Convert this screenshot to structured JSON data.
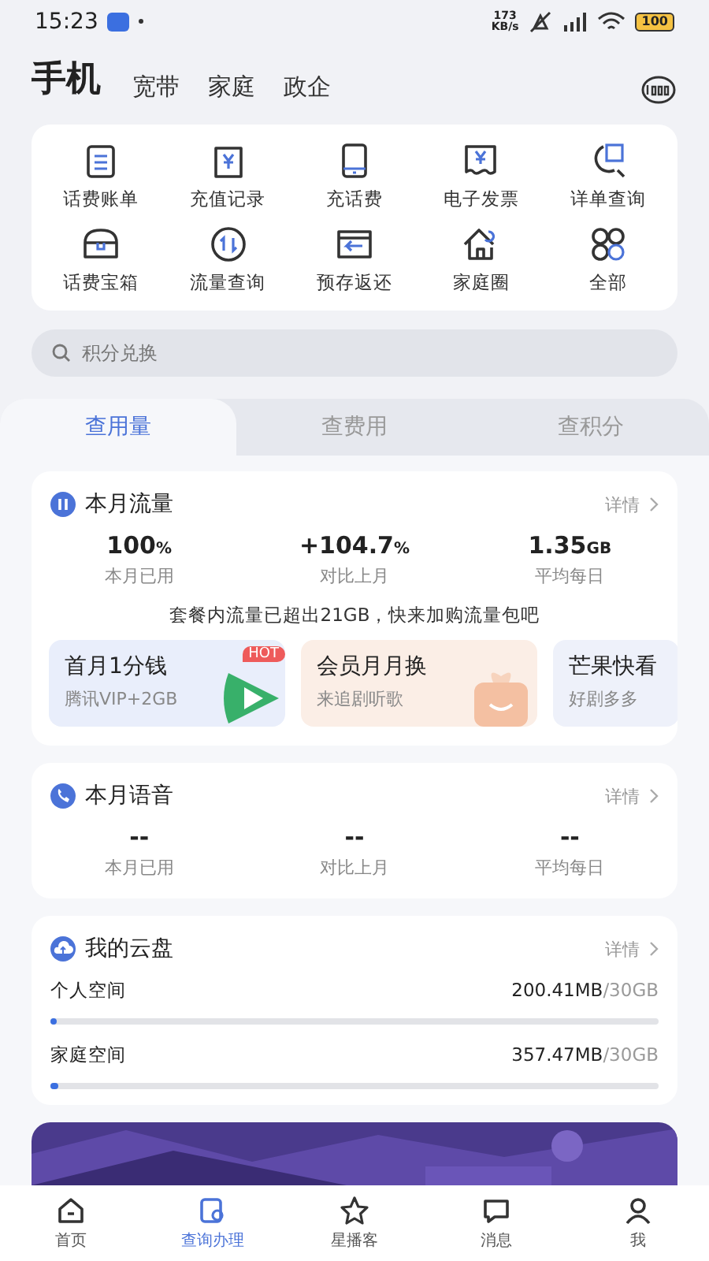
{
  "status_bar": {
    "time": "15:23",
    "speed": "173\nKB/s",
    "battery": "100"
  },
  "header": {
    "tabs": [
      {
        "label": "手机",
        "selected": true
      },
      {
        "label": "宽带",
        "selected": false
      },
      {
        "label": "家庭",
        "selected": false
      },
      {
        "label": "政企",
        "selected": false
      }
    ]
  },
  "shortcuts": [
    {
      "label": "话费账单"
    },
    {
      "label": "充值记录"
    },
    {
      "label": "充话费"
    },
    {
      "label": "电子发票"
    },
    {
      "label": "详单查询"
    },
    {
      "label": "话费宝箱"
    },
    {
      "label": "流量查询"
    },
    {
      "label": "预存返还"
    },
    {
      "label": "家庭圈"
    },
    {
      "label": "全部"
    }
  ],
  "search": {
    "placeholder": "积分兑换"
  },
  "query_tabs": [
    {
      "label": "查用量",
      "selected": true
    },
    {
      "label": "查费用",
      "selected": false
    },
    {
      "label": "查积分",
      "selected": false
    }
  ],
  "data_card": {
    "title": "本月流量",
    "more": "详情",
    "stats": [
      {
        "value": "100",
        "unit": "%",
        "label": "本月已用"
      },
      {
        "value": "+104.7",
        "unit": "%",
        "label": "对比上月"
      },
      {
        "value": "1.35",
        "unit": "GB",
        "label": "平均每日"
      }
    ],
    "notice": "套餐内流量已超出21GB，快来加购流量包吧",
    "promos": [
      {
        "kind": "video",
        "title": "首月1分钱",
        "subtitle": "腾讯VIP+2GB",
        "badge": "HOT"
      },
      {
        "kind": "gift",
        "title": "会员月月换",
        "subtitle": "来追剧听歌"
      },
      {
        "kind": "plain",
        "title": "芒果快看",
        "subtitle": "好剧多多"
      }
    ]
  },
  "voice_card": {
    "title": "本月语音",
    "more": "详情",
    "stats": [
      {
        "value": "--",
        "label": "本月已用"
      },
      {
        "value": "--",
        "label": "对比上月"
      },
      {
        "value": "--",
        "label": "平均每日"
      }
    ]
  },
  "cloud_card": {
    "title": "我的云盘",
    "more": "详情",
    "spaces": [
      {
        "name": "个人空间",
        "used": "200.41MB",
        "total": "/30GB",
        "level": 0.007
      },
      {
        "name": "家庭空间",
        "used": "357.47MB",
        "total": "/30GB",
        "level": 0.012
      }
    ]
  },
  "nav": [
    {
      "label": "首页",
      "selected": false
    },
    {
      "label": "查询办理",
      "selected": true
    },
    {
      "label": "星播客",
      "selected": false
    },
    {
      "label": "消息",
      "selected": false
    },
    {
      "label": "我",
      "selected": false
    }
  ]
}
